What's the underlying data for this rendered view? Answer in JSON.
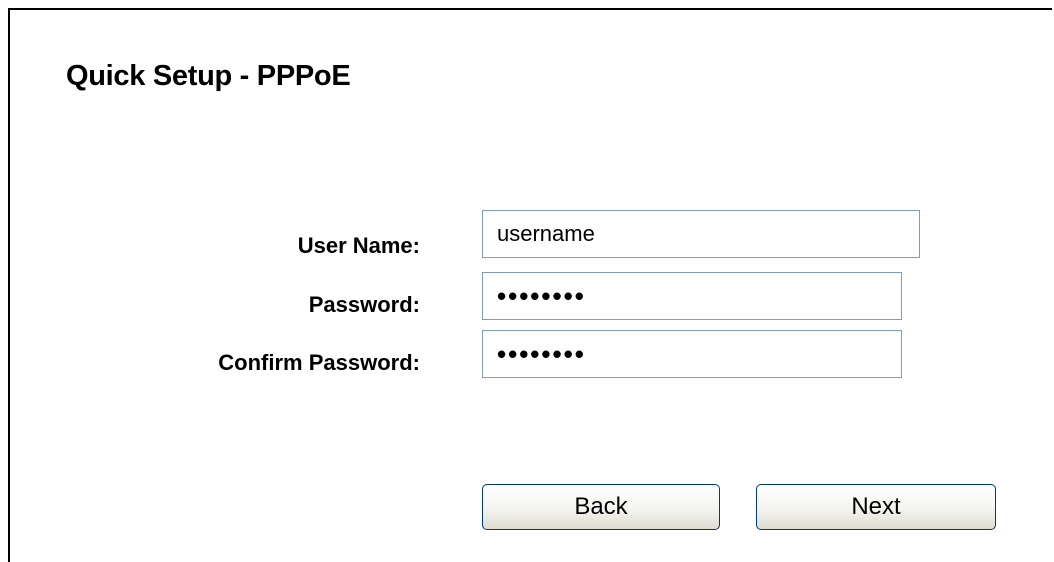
{
  "page": {
    "title": "Quick Setup - PPPoE"
  },
  "form": {
    "user_name_label": "User Name:",
    "user_name_value": "username",
    "password_label": "Password:",
    "password_value": "••••••••",
    "confirm_password_label": "Confirm Password:",
    "confirm_password_value": "••••••••"
  },
  "buttons": {
    "back_label": "Back",
    "next_label": "Next"
  },
  "colors": {
    "input_border": "#7f9db9",
    "button_border": "#003c74"
  }
}
